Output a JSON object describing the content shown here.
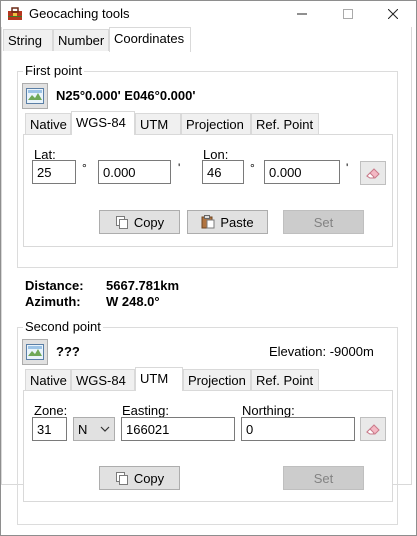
{
  "window": {
    "title": "Geocaching tools"
  },
  "main_tabs": [
    {
      "label": "String"
    },
    {
      "label": "Number"
    },
    {
      "label": "Coordinates"
    }
  ],
  "first_point": {
    "group_label": "First point",
    "coordinate": "N25°0.000' E046°0.000'",
    "tabs": [
      {
        "label": "Native"
      },
      {
        "label": "WGS-84"
      },
      {
        "label": "UTM"
      },
      {
        "label": "Projection"
      },
      {
        "label": "Ref. Point"
      }
    ],
    "lat_label": "Lat:",
    "lat_deg": "25",
    "lat_min": "0.000",
    "lon_label": "Lon:",
    "lon_deg": "46",
    "lon_min": "0.000",
    "deg_symbol": "°",
    "min_symbol": "'",
    "copy_label": "Copy",
    "paste_label": "Paste",
    "set_label": "Set"
  },
  "distance_label": "Distance:",
  "distance_value": "5667.781km",
  "azimuth_label": "Azimuth:",
  "azimuth_value": "W 248.0°",
  "second_point": {
    "group_label": "Second point",
    "coordinate": "???",
    "elevation": "Elevation: -9000m",
    "tabs": [
      {
        "label": "Native"
      },
      {
        "label": "WGS-84"
      },
      {
        "label": "UTM"
      },
      {
        "label": "Projection"
      },
      {
        "label": "Ref. Point"
      }
    ],
    "zone_label": "Zone:",
    "zone_value": "31",
    "hemisphere_value": "N",
    "easting_label": "Easting:",
    "easting_value": "166021",
    "northing_label": "Northing:",
    "northing_value": "0",
    "copy_label": "Copy",
    "set_label": "Set"
  }
}
